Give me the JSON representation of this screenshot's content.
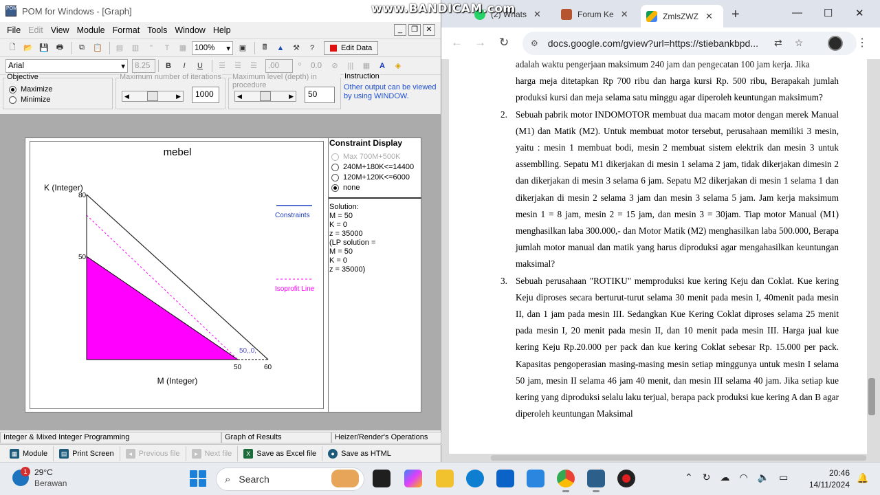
{
  "pom": {
    "title": "POM for Windows - [Graph]",
    "app_icon_text": "POM",
    "menu": [
      "File",
      "Edit",
      "View",
      "Module",
      "Format",
      "Tools",
      "Window",
      "Help"
    ],
    "toolbar": {
      "zoom": "100%",
      "edit_data": "Edit Data"
    },
    "format_bar": {
      "font": "Arial",
      "size": "8.25",
      "decimals": ".00",
      "fraction": "0.0"
    },
    "objective": {
      "label": "Objective",
      "maximize": "Maximize",
      "minimize": "Minimize",
      "selected": "Maximize"
    },
    "max_iterations": {
      "label": "Maximum number of iterations",
      "value": "1000"
    },
    "max_level": {
      "label": "Maximum level (depth) in procedure",
      "value": "50"
    },
    "instruction": {
      "label": "Instruction",
      "text": "Other output can be viewed by using WINDOW."
    },
    "status": [
      "Integer & Mixed Integer Programming",
      "Graph of Results",
      "Heizer/Render's Operations"
    ],
    "bottom_buttons": [
      "Module",
      "Print Screen",
      "Previous file",
      "Next file",
      "Save as Excel file",
      "Save as HTML"
    ]
  },
  "graph": {
    "title": "mebel",
    "y_label": "K (Integer)",
    "x_label": "M (Integer)",
    "y_ticks": [
      "80",
      "50"
    ],
    "x_ticks": [
      "50",
      "60"
    ],
    "point_label": "50,,0,",
    "legend_constraints": "Constraints",
    "legend_isoprofit": "Isoprofit Line",
    "colors": {
      "feasible": "#ff00ff",
      "isoprofit": "#ff00ff",
      "constraints": "#1f3fbf"
    }
  },
  "chart_data": {
    "type": "line",
    "title": "mebel",
    "xlabel": "M (Integer)",
    "ylabel": "K (Integer)",
    "series": [
      {
        "name": "Constraints",
        "x": [
          0,
          60
        ],
        "y": [
          80,
          0
        ]
      },
      {
        "x": [
          0,
          50
        ],
        "y": [
          50,
          0
        ]
      },
      {
        "name": "Isoprofit Line",
        "x": [
          0,
          50
        ],
        "y": [
          70,
          0
        ]
      }
    ],
    "feasible_region": [
      [
        0,
        0
      ],
      [
        0,
        50
      ],
      [
        50,
        0
      ]
    ],
    "optimum": {
      "x": 50,
      "y": 0
    }
  },
  "constraint_display": {
    "title": "Constraint Display",
    "options": [
      "Max 700M+500K",
      "240M+180K<=14400",
      "120M+120K<=6000",
      "none"
    ],
    "selected": "none",
    "solution_lines": [
      "Solution:",
      "M =  50",
      "K =  0",
      "z =  35000",
      "(LP solution =",
      "M =  50",
      "K =  0",
      "z =  35000)"
    ]
  },
  "browser": {
    "watermark": "www.BANDICAM.com",
    "tabs": [
      {
        "label": "(2) Whats",
        "icon": "whatsapp-icon"
      },
      {
        "label": "Forum Ke",
        "icon": "forum-icon"
      },
      {
        "label": "ZmlsZWZ",
        "icon": "google-drive-icon"
      }
    ],
    "url": "docs.google.com/gview?url=https://stiebankbpd..."
  },
  "document": {
    "cut_line": "adalah waktu pengerjaan maksimum 240 jam dan pengecatan 100 jam kerja. Jika",
    "q1_tail": "harga meja ditetapkan Rp 700 ribu dan harga kursi Rp. 500 ribu, Berapakah jumlah produksi kursi dan meja selama satu minggu agar diperoleh keuntungan maksimum?",
    "questions": [
      {
        "num": "2.",
        "text": "Sebuah pabrik motor INDOMOTOR membuat dua macam motor dengan merek Manual (M1) dan Matik (M2). Untuk membuat motor tersebut, perusahaan memiliki 3 mesin, yaitu : mesin 1 membuat bodi, mesin 2 membuat sistem elektrik dan mesin 3 untuk assemblling. Sepatu M1 dikerjakan di mesin 1 selama 2 jam, tidak dikerjakan dimesin 2 dan dikerjakan di mesin 3 selama 6 jam. Sepatu M2 dikerjakan di mesin 1 selama 1 dan dikerjakan di mesin 2 selama 3 jam dan mesin 3 selama 5 jam. Jam kerja maksimum mesin 1 = 8 jam, mesin 2 = 15 jam, dan mesin 3 = 30jam. Tiap motor Manual (M1) menghasilkan laba 300.000,- dan Motor Matik (M2) menghasilkan laba 500.000, Berapa jumlah motor manual dan matik yang harus diproduksi agar mengahasilkan keuntungan maksimal?"
      },
      {
        "num": "3.",
        "text": "Sebuah perusahaan \"ROTIKU\" memproduksi kue kering Keju dan Coklat. Kue kering Keju diproses secara berturut-turut selama 30 menit pada mesin I, 40menit pada mesin II, dan 1 jam pada mesin III. Sedangkan Kue Kering Coklat diproses selama 25 menit pada mesin I, 20 menit pada mesin II, dan 10 menit pada mesin III. Harga jual kue kering Keju Rp.20.000 per pack dan kue kering Coklat sebesar Rp. 15.000 per pack. Kapasitas pengoperasian masing-masing mesin setiap minggunya untuk mesin I selama 50 jam, mesin II selama 46 jam 40 menit, dan mesin III selama 40 jam. Jika setiap kue kering yang diproduksi selalu laku terjual, berapa pack produksi kue kering A dan B agar diperoleh keuntungan Maksimal"
      }
    ]
  },
  "taskbar": {
    "weather_temp": "29°C",
    "weather_desc": "Berawan",
    "weather_badge": "1",
    "search_placeholder": "Search",
    "time": "20:46",
    "date": "14/11/2024"
  }
}
